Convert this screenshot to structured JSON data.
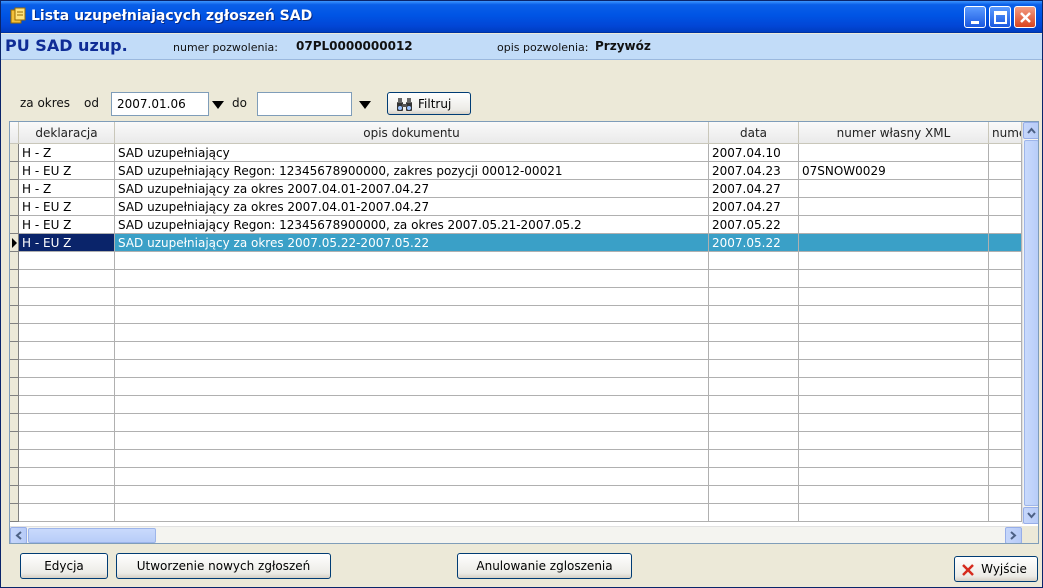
{
  "window": {
    "title": "Lista uzupełniających zgłoszeń SAD",
    "minimize_icon": "minimize-icon",
    "maximize_icon": "maximize-icon",
    "close_icon": "close-icon"
  },
  "info": {
    "title": "PU SAD uzup.",
    "permit_number_label": "numer pozwolenia:",
    "permit_number_value": "07PL0000000012",
    "permit_desc_label": "opis pozwolenia:",
    "permit_desc_value": "Przywóz"
  },
  "filter": {
    "period_label": "za okres",
    "from_label": "od",
    "from_value": "2007.01.06",
    "to_label": "do",
    "to_value": "",
    "filter_button": "Filtruj"
  },
  "grid": {
    "columns": [
      "deklaracja",
      "opis dokumentu",
      "data",
      "numer własny XML",
      "numer"
    ],
    "rows": [
      {
        "deklaracja": "H - Z",
        "opis": "SAD uzupełniający",
        "data": "2007.04.10",
        "xml": "",
        "nr": ""
      },
      {
        "deklaracja": "H - EU Z",
        "opis": "SAD uzupełniający Regon: 12345678900000, zakres pozycji 00012-00021",
        "data": "2007.04.23",
        "xml": "07SNOW0029",
        "nr": ""
      },
      {
        "deklaracja": "H - Z",
        "opis": "SAD uzupełniający za okres 2007.04.01-2007.04.27",
        "data": "2007.04.27",
        "xml": "",
        "nr": ""
      },
      {
        "deklaracja": "H - EU Z",
        "opis": "SAD uzupełniający za okres 2007.04.01-2007.04.27",
        "data": "2007.04.27",
        "xml": "",
        "nr": ""
      },
      {
        "deklaracja": "H - EU Z",
        "opis": "SAD uzupełniający Regon: 12345678900000, za okres 2007.05.21-2007.05.2",
        "data": "2007.05.22",
        "xml": "",
        "nr": ""
      },
      {
        "deklaracja": "H - EU Z",
        "opis": "SAD uzupełniający za okres 2007.05.22-2007.05.22",
        "data": "2007.05.22",
        "xml": "",
        "nr": "",
        "selected": true
      }
    ]
  },
  "buttons": {
    "edit": "Edycja",
    "create": "Utworzenie nowych zgłoszeń",
    "cancel": "Anulowanie zgloszenia",
    "exit": "Wyjście"
  },
  "colors": {
    "titlebar": "#0055e5",
    "infobar": "#c2dcf8",
    "selected_row": "#3aa0c7",
    "selected_indicator": "#0a246a"
  }
}
